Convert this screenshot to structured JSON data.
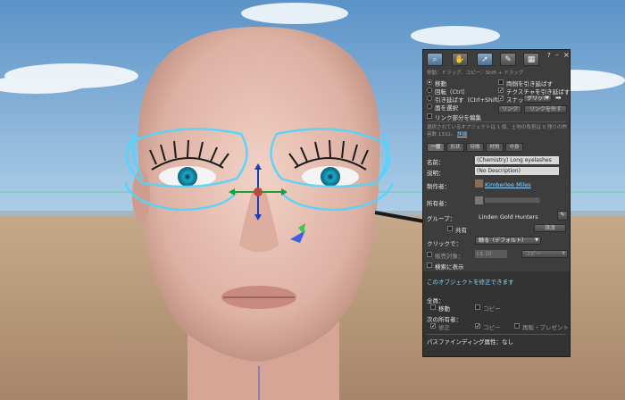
{
  "toolbar": {
    "tools": [
      {
        "name": "focus",
        "icon": "magnifier-icon"
      },
      {
        "name": "move",
        "icon": "hand-icon"
      },
      {
        "name": "edit",
        "icon": "pointer-icon"
      },
      {
        "name": "create",
        "icon": "wand-icon"
      },
      {
        "name": "land",
        "icon": "bulldozer-icon"
      }
    ],
    "help": "?",
    "minimize": "–",
    "close": "×",
    "hint": "移動：ドラッグ、コピー：Shift + ドラッグ"
  },
  "modes": {
    "move": "移動",
    "rotate": "回転（Ctrl）",
    "stretch": "引き延ばす（Ctrl+Shift）",
    "select_face": "面を選択",
    "stretch_both": "両側を引き延ばす",
    "stretch_textures": "テクスチャを引き延ばす",
    "snap": "スナップ",
    "snap_option": "グリッド",
    "link_label": "リンク",
    "unlink_label": "リンクを外す",
    "edit_linked": "リンク部分を編集"
  },
  "selection_info": "選択されているオブジェクトは 1 個、土地の負担は 0 残りの許容数 1332。",
  "selection_details_link": "詳細",
  "tabs": [
    "一般",
    "形状",
    "特徴",
    "材質",
    "中身"
  ],
  "general": {
    "name_label": "名前：",
    "name_value": "(Chemistry) Long eyelashes",
    "desc_label": "説明：",
    "desc_value": "(No Description)",
    "creator_label": "制作者：",
    "creator_value": "Kimberlee Miles",
    "owner_label": "所有者：",
    "owner_value": "▒▒▒▒▒▒▒▒▒▒▒▒▒▒▒▒",
    "group_label": "グループ：",
    "group_value": "Linden Gold Hunters",
    "share_label": "共有",
    "deed_button": "譲渡",
    "click_label": "クリックで：",
    "click_value": "触る（デフォルト）",
    "for_sale_label": "販売対象：",
    "price_value": "L$ 10",
    "sale_type_value": "コピー",
    "show_in_search": "検索に表示",
    "modify_notice": "このオブジェクトを修正できます",
    "everyone_label": "全員：",
    "move_perm": "移動",
    "copy_perm": "コピー",
    "next_owner_label": "次の所有者：",
    "modify_perm": "修正",
    "copy_perm2": "コピー",
    "transfer_perm": "再販・プレゼント",
    "pathfinding_label": "パスファインディング属性：",
    "pathfinding_value": "なし"
  },
  "colors": {
    "panel_bg": "#3d3d3d",
    "accent_link": "#8fd4ff",
    "field_bg": "#d9d9d9"
  }
}
